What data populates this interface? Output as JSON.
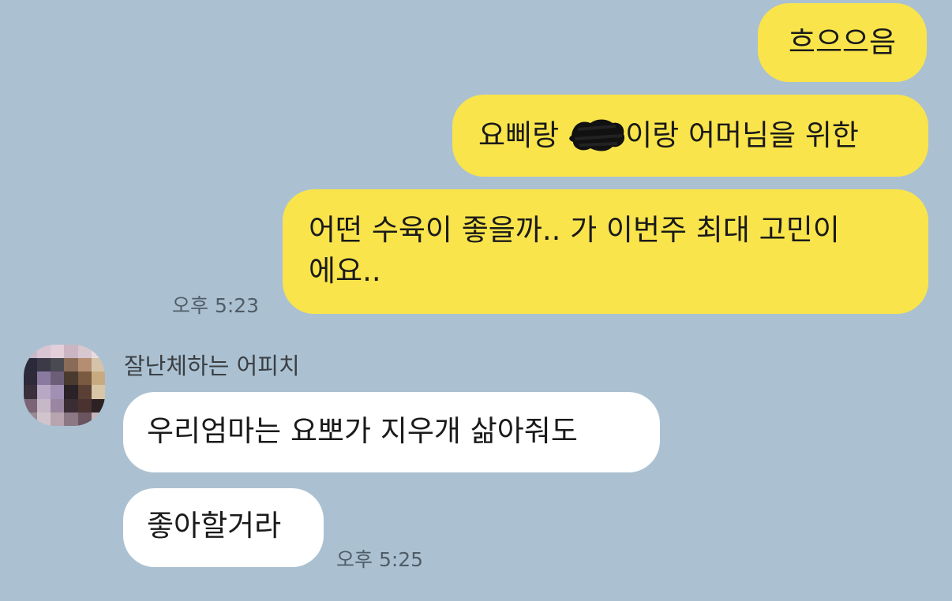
{
  "chat": {
    "outgoing": {
      "msg1": "흐으으음",
      "msg2_before": "요삐랑",
      "msg2_after": "이랑 어머님을 위한",
      "msg3_line1": "어떤 수육이 좋을까.. 가 이번주 최대 고민이",
      "msg3_line2": "에요..",
      "time": "오후 5:23"
    },
    "incoming": {
      "sender": "잘난체하는 어피치",
      "msg1": "우리엄마는 요뽀가 지우개 삶아줘도",
      "msg2": "좋아할거라",
      "time": "오후 5:25"
    }
  },
  "colors": {
    "background": "#abc1d1",
    "my_bubble": "#f9e44b",
    "other_bubble": "#ffffff"
  },
  "icons": {
    "avatar": "pixelated-profile-avatar",
    "redaction": "scribble-redaction-mark"
  }
}
